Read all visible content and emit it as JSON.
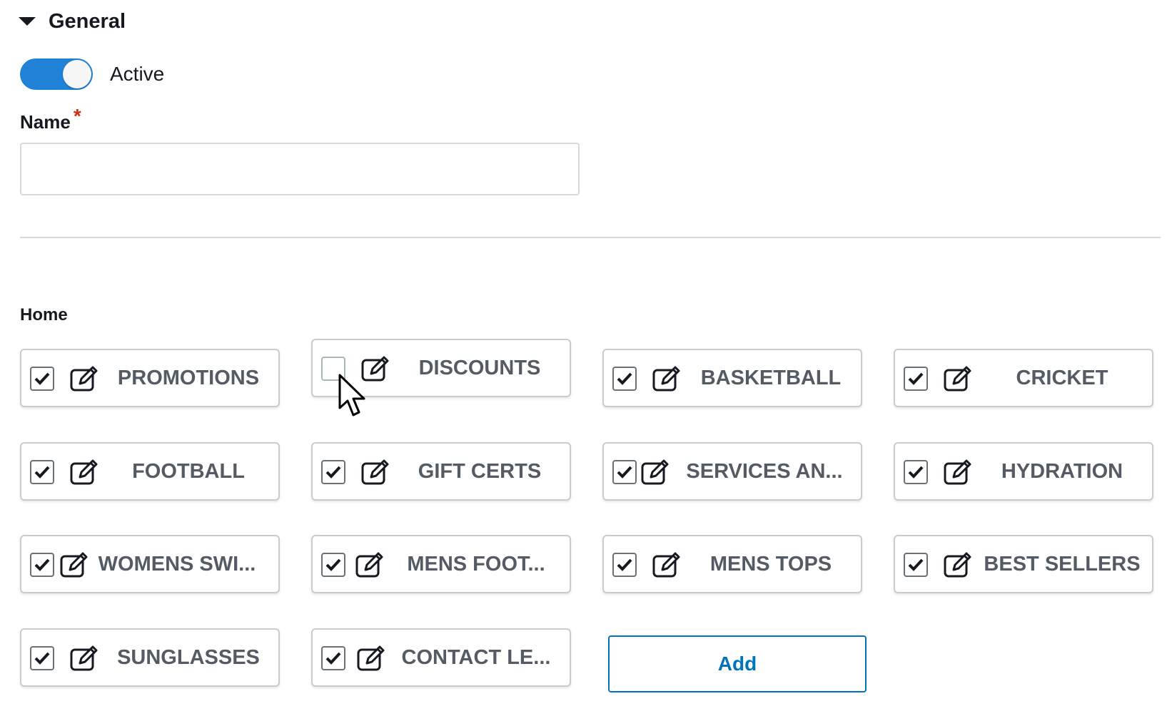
{
  "section": {
    "title": "General"
  },
  "toggle": {
    "label": "Active",
    "on": true
  },
  "name_field": {
    "label": "Name",
    "required_marker": "*",
    "value": "",
    "placeholder": ""
  },
  "home": {
    "label": "Home",
    "tiles": [
      {
        "label": "PROMOTIONS",
        "checked": true
      },
      {
        "label": "DISCOUNTS",
        "checked": false
      },
      {
        "label": "BASKETBALL",
        "checked": true
      },
      {
        "label": "CRICKET",
        "checked": true
      },
      {
        "label": "FOOTBALL",
        "checked": true
      },
      {
        "label": "GIFT CERTS",
        "checked": true
      },
      {
        "label": "SERVICES AN...",
        "checked": true
      },
      {
        "label": "HYDRATION",
        "checked": true
      },
      {
        "label": "WOMENS SWI...",
        "checked": true
      },
      {
        "label": "MENS FOOT...",
        "checked": true
      },
      {
        "label": "MENS TOPS",
        "checked": true
      },
      {
        "label": "BEST SELLERS",
        "checked": true
      },
      {
        "label": "SUNGLASSES",
        "checked": true
      },
      {
        "label": "CONTACT LE...",
        "checked": true
      }
    ],
    "add_label": "Add"
  },
  "colors": {
    "accent": "#1f82d6",
    "link": "#0073bb",
    "required": "#d13212",
    "tile_text": "#545b64"
  },
  "icons": {
    "check": "checkmark-icon",
    "edit": "edit-icon",
    "caret": "caret-down-icon",
    "cursor": "mouse-pointer-icon"
  }
}
